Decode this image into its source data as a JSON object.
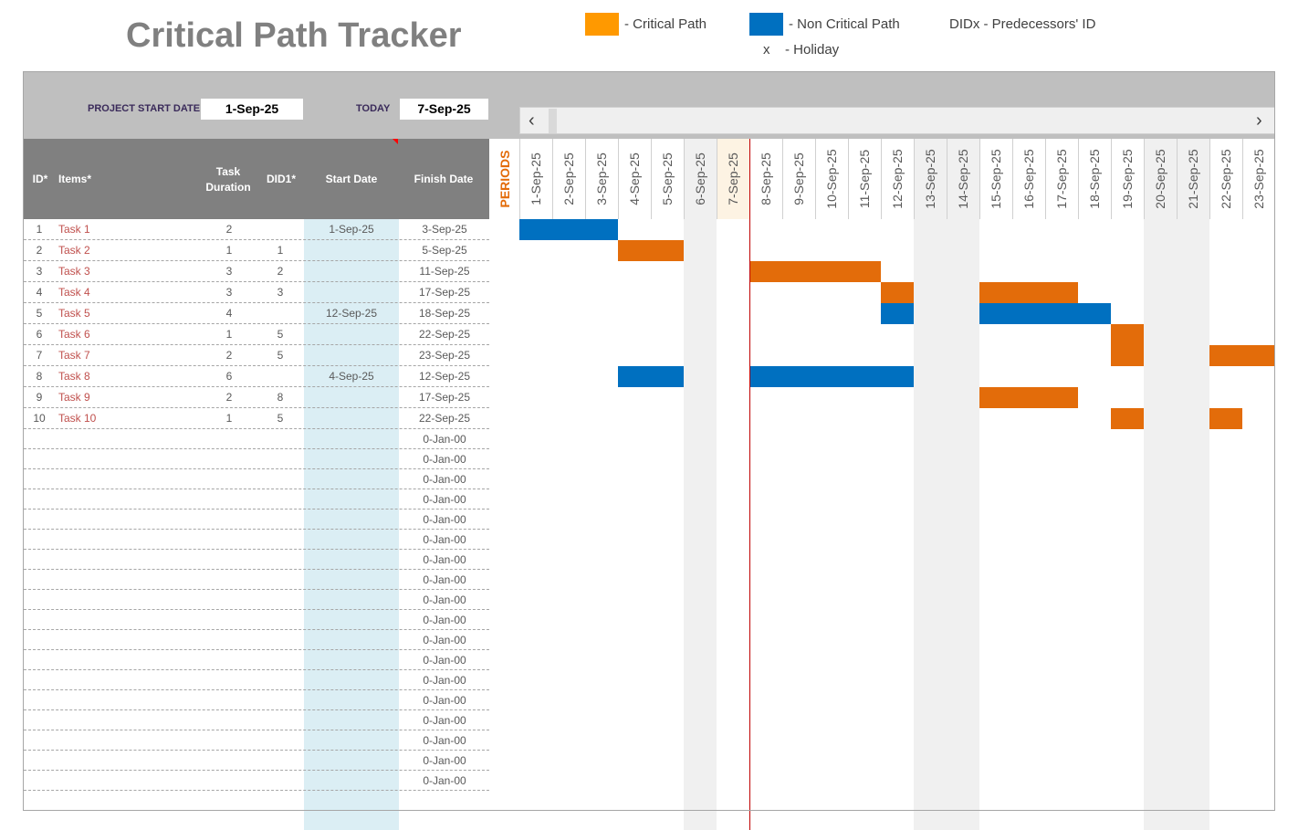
{
  "title": "Critical Path Tracker",
  "legend": {
    "critical_label": "- Critical Path",
    "critical_color": "#ff9900",
    "noncritical_label": "- Non Critical Path",
    "noncritical_color": "#0070c0",
    "did_label": "DIDx - Predecessors' ID",
    "holiday_mark": "x",
    "holiday_label": "- Holiday"
  },
  "header": {
    "project_start_label": "PROJECT START DATE",
    "project_start_value": "1-Sep-25",
    "today_label": "TODAY",
    "today_value": "7-Sep-25"
  },
  "columns": {
    "id": "ID*",
    "items": "Items*",
    "duration_l1": "Task",
    "duration_l2": "Duration",
    "did": "DID1*",
    "start": "Start Date",
    "finish": "Finish Date",
    "periods": "PERIODS"
  },
  "scroll": {
    "left": "‹",
    "right": "›"
  },
  "colors": {
    "critical_bar": "#e36c0a",
    "noncritical_bar": "#0070c0",
    "weekend_shade": "#f0f0f0",
    "today_shade": "#fdf3e3",
    "today_line": "#c00000",
    "start_col_fill": "#dbeef4"
  },
  "tasks": [
    {
      "id": "1",
      "name": "Task 1",
      "duration": "2",
      "did": "",
      "start": "1-Sep-25",
      "finish": "3-Sep-25"
    },
    {
      "id": "2",
      "name": "Task 2",
      "duration": "1",
      "did": "1",
      "start": "",
      "finish": "5-Sep-25"
    },
    {
      "id": "3",
      "name": "Task 3",
      "duration": "3",
      "did": "2",
      "start": "",
      "finish": "11-Sep-25"
    },
    {
      "id": "4",
      "name": "Task 4",
      "duration": "3",
      "did": "3",
      "start": "",
      "finish": "17-Sep-25"
    },
    {
      "id": "5",
      "name": "Task 5",
      "duration": "4",
      "did": "",
      "start": "12-Sep-25",
      "finish": "18-Sep-25"
    },
    {
      "id": "6",
      "name": "Task 6",
      "duration": "1",
      "did": "5",
      "start": "",
      "finish": "22-Sep-25"
    },
    {
      "id": "7",
      "name": "Task 7",
      "duration": "2",
      "did": "5",
      "start": "",
      "finish": "23-Sep-25"
    },
    {
      "id": "8",
      "name": "Task 8",
      "duration": "6",
      "did": "",
      "start": "4-Sep-25",
      "finish": "12-Sep-25"
    },
    {
      "id": "9",
      "name": "Task 9",
      "duration": "2",
      "did": "8",
      "start": "",
      "finish": "17-Sep-25"
    },
    {
      "id": "10",
      "name": "Task 10",
      "duration": "1",
      "did": "5",
      "start": "",
      "finish": "22-Sep-25"
    }
  ],
  "empty_finish": [
    "0-Jan-00",
    "0-Jan-00",
    "0-Jan-00",
    "0-Jan-00",
    "0-Jan-00",
    "0-Jan-00",
    "0-Jan-00",
    "0-Jan-00",
    "0-Jan-00",
    "0-Jan-00",
    "0-Jan-00",
    "0-Jan-00",
    "0-Jan-00",
    "0-Jan-00",
    "0-Jan-00",
    "0-Jan-00",
    "0-Jan-00",
    "0-Jan-00"
  ],
  "chart_data": {
    "type": "gantt",
    "days": [
      "1-Sep-25",
      "2-Sep-25",
      "3-Sep-25",
      "4-Sep-25",
      "5-Sep-25",
      "6-Sep-25",
      "7-Sep-25",
      "8-Sep-25",
      "9-Sep-25",
      "10-Sep-25",
      "11-Sep-25",
      "12-Sep-25",
      "13-Sep-25",
      "14-Sep-25",
      "15-Sep-25",
      "16-Sep-25",
      "17-Sep-25",
      "18-Sep-25",
      "19-Sep-25",
      "20-Sep-25",
      "21-Sep-25",
      "22-Sep-25",
      "23-Sep-25"
    ],
    "weekend_days": [
      "6-Sep-25",
      "13-Sep-25",
      "14-Sep-25",
      "20-Sep-25",
      "21-Sep-25"
    ],
    "today": "7-Sep-25",
    "bars": [
      {
        "task": "1",
        "start": "1-Sep-25",
        "end": "3-Sep-25",
        "path": "non-critical"
      },
      {
        "task": "2",
        "start": "4-Sep-25",
        "end": "5-Sep-25",
        "path": "critical"
      },
      {
        "task": "3",
        "start": "8-Sep-25",
        "end": "11-Sep-25",
        "path": "critical"
      },
      {
        "task": "4",
        "start": "12-Sep-25",
        "end": "12-Sep-25",
        "path": "critical"
      },
      {
        "task": "4",
        "start": "15-Sep-25",
        "end": "17-Sep-25",
        "path": "critical"
      },
      {
        "task": "5",
        "start": "12-Sep-25",
        "end": "12-Sep-25",
        "path": "non-critical"
      },
      {
        "task": "5",
        "start": "15-Sep-25",
        "end": "18-Sep-25",
        "path": "non-critical"
      },
      {
        "task": "6",
        "start": "19-Sep-25",
        "end": "19-Sep-25",
        "path": "critical"
      },
      {
        "task": "7",
        "start": "19-Sep-25",
        "end": "19-Sep-25",
        "path": "critical"
      },
      {
        "task": "7",
        "start": "22-Sep-25",
        "end": "23-Sep-25",
        "path": "critical"
      },
      {
        "task": "8",
        "start": "4-Sep-25",
        "end": "5-Sep-25",
        "path": "non-critical"
      },
      {
        "task": "8",
        "start": "8-Sep-25",
        "end": "12-Sep-25",
        "path": "non-critical"
      },
      {
        "task": "9",
        "start": "15-Sep-25",
        "end": "17-Sep-25",
        "path": "critical"
      },
      {
        "task": "10",
        "start": "19-Sep-25",
        "end": "19-Sep-25",
        "path": "critical"
      },
      {
        "task": "10",
        "start": "22-Sep-25",
        "end": "22-Sep-25",
        "path": "critical"
      }
    ]
  }
}
